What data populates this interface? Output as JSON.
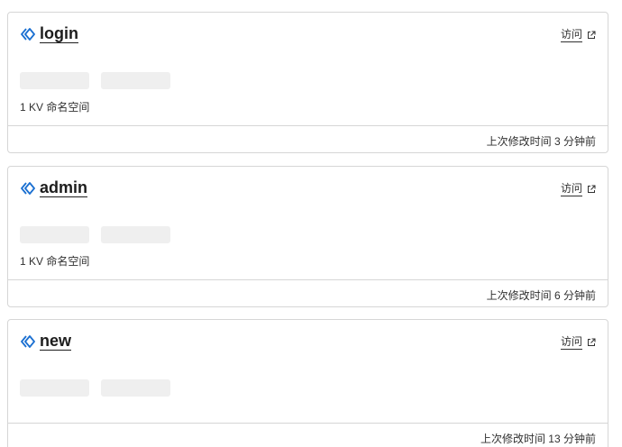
{
  "colors": {
    "accent": "#1a6fd1",
    "border": "#d6d6d6",
    "skeleton": "#efefef",
    "text": "#313131"
  },
  "icons": {
    "worker": "worker-diamond-icon",
    "external": "external-link-icon"
  },
  "workers": [
    {
      "name": "login",
      "visit_label": "访问",
      "kv_namespaces": "1 KV 命名空间",
      "modified": "上次修改时间 3 分钟前"
    },
    {
      "name": "admin",
      "visit_label": "访问",
      "kv_namespaces": "1 KV 命名空间",
      "modified": "上次修改时间 6 分钟前"
    },
    {
      "name": "new",
      "visit_label": "访问",
      "modified": "上次修改时间 13 分钟前"
    }
  ]
}
